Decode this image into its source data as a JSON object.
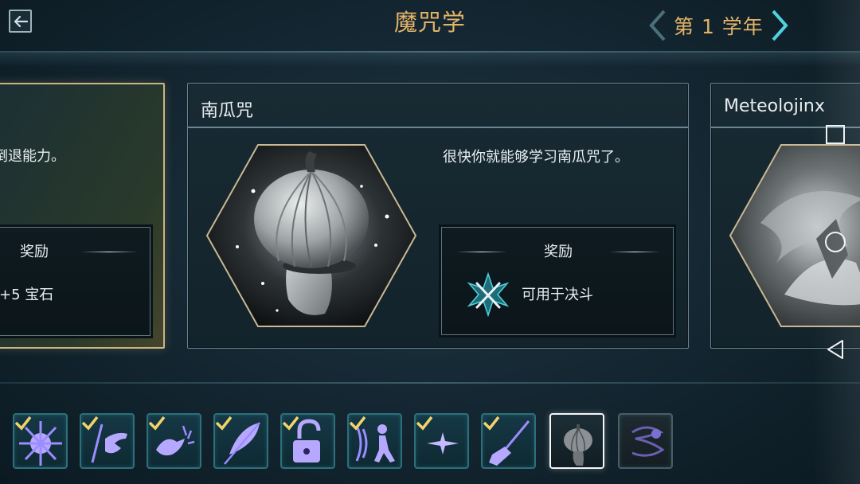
{
  "header": {
    "title": "魔咒学",
    "year_label": "第 1 学年"
  },
  "cards": {
    "left": {
      "desc": "倒退能力。",
      "reward_title": "奖励",
      "reward_text": "+5 宝石"
    },
    "center": {
      "title": "南瓜咒",
      "desc": "很快你就能够学习南瓜咒了。",
      "reward_title": "奖励",
      "reward_text": "可用于决斗"
    },
    "right": {
      "title": "Meteolojinx"
    }
  },
  "spellbar": {
    "items": [
      {
        "icon": "burst-star-icon",
        "state": "learned"
      },
      {
        "icon": "hand-slash-icon",
        "state": "learned"
      },
      {
        "icon": "hand-shatter-icon",
        "state": "learned"
      },
      {
        "icon": "feather-icon",
        "state": "learned"
      },
      {
        "icon": "padlock-icon",
        "state": "learned"
      },
      {
        "icon": "figure-wave-icon",
        "state": "learned"
      },
      {
        "icon": "sparkle-icon",
        "state": "learned"
      },
      {
        "icon": "broom-icon",
        "state": "learned"
      },
      {
        "icon": "pumpkin-head-icon",
        "state": "selected"
      },
      {
        "icon": "swirl-cloud-icon",
        "state": "locked"
      }
    ]
  },
  "colors": {
    "gold": "#e3b468",
    "teal": "#4fd3e0",
    "check_yellow": "#f2d36b",
    "spell_purple": "#9b8cff"
  }
}
